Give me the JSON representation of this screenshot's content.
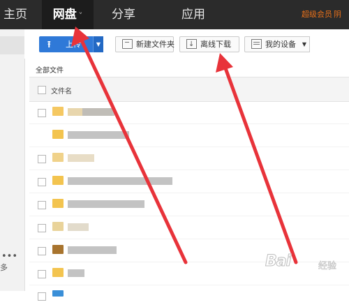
{
  "nav": {
    "home": "主页",
    "disk": "网盘",
    "disk_chevron": "˅",
    "share": "分享",
    "apps": "应用",
    "super_member": "超级会员",
    "user_name": "阴"
  },
  "toolbar": {
    "upload_label": "上传",
    "new_folder": "新建文件夹",
    "offline_download": "离线下载",
    "my_devices": "我的设备"
  },
  "breadcrumb": "全部文件",
  "list": {
    "column_name": "文件名"
  },
  "sidebar": {
    "dots": "•••",
    "more": "多"
  },
  "watermark": {
    "main": "Bai",
    "sub": "经验"
  },
  "colors": {
    "topbar": "#2b2b2b",
    "upload_blue": "#2f79d8",
    "arrow_red": "#e8333a",
    "member_orange": "#e8701a"
  }
}
